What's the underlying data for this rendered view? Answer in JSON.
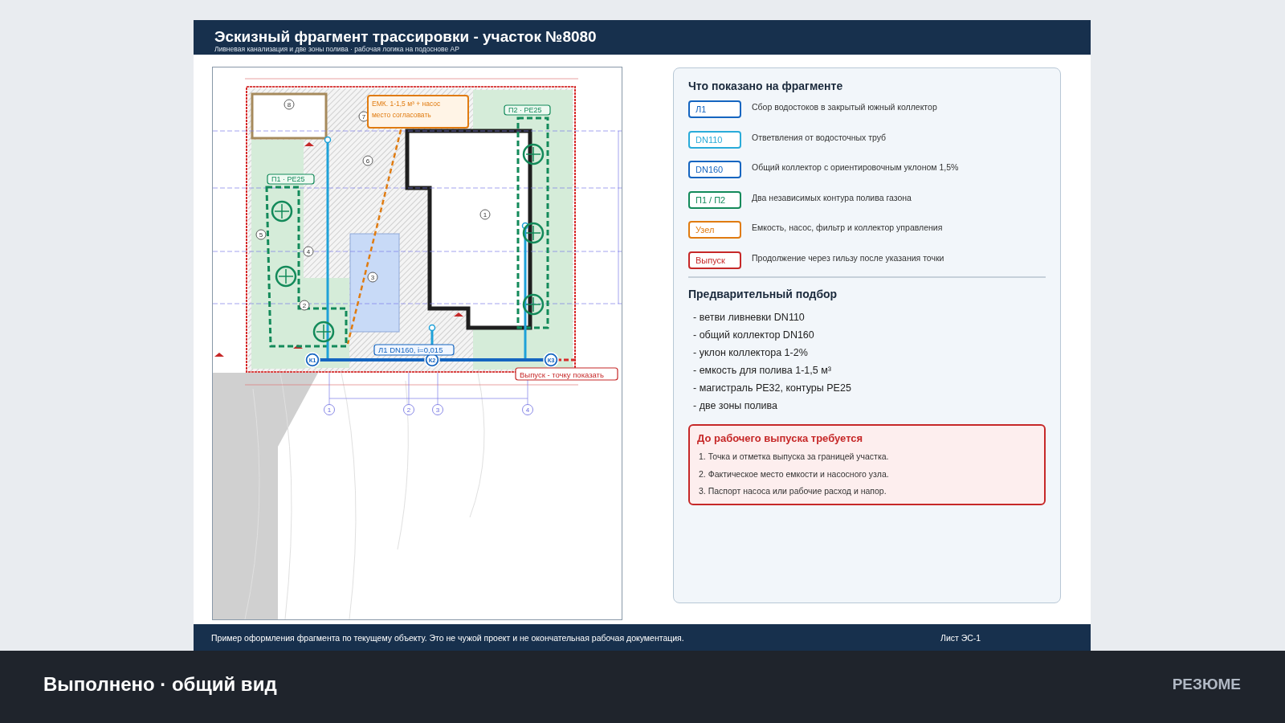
{
  "header": {
    "title": "Эскизный фрагмент трассировки - участок №8080",
    "subtitle": "Ливневая канализация и две зоны полива · рабочая логика на подоснове АР"
  },
  "plan": {
    "callouts": [
      {
        "kind": "tank",
        "lines": [
          "ЕМК. 1-1,5 м³ + насос",
          "место согласовать"
        ]
      },
      {
        "kind": "loop",
        "lines": [
          "П1 · PE25"
        ]
      },
      {
        "kind": "loop",
        "lines": [
          "П2 · PE25"
        ]
      },
      {
        "kind": "pipe",
        "lines": [
          "Л1 DN160, i=0,015"
        ]
      },
      {
        "kind": "outlet",
        "lines": [
          "Выпуск - точку показать"
        ]
      }
    ],
    "nodes": [
      "К1",
      "К2",
      "К3"
    ],
    "rooms": [
      "8",
      "7",
      "6",
      "5",
      "4",
      "3",
      "2",
      "1"
    ],
    "axes": [
      "1",
      "2",
      "3",
      "4"
    ]
  },
  "legend": {
    "title": "Что показано на фрагменте",
    "items": [
      {
        "tag": "Л1",
        "text": "Сбор водостоков в закрытый южный коллектор",
        "color": "#1565c0"
      },
      {
        "tag": "DN110",
        "text": "Ответвления от водосточных труб",
        "color": "#29abd9"
      },
      {
        "tag": "DN160",
        "text": "Общий коллектор с ориентировочным уклоном 1,5%",
        "color": "#1565c0"
      },
      {
        "tag": "П1 / П2",
        "text": "Два независимых контура полива газона",
        "color": "#138a5a"
      },
      {
        "tag": "Узел",
        "text": "Емкость, насос, фильтр и коллектор управления",
        "color": "#e07b10"
      },
      {
        "tag": "Выпуск",
        "text": "Продолжение через гильзу после указания точки",
        "color": "#c62828"
      }
    ]
  },
  "selection": {
    "title": "Предварительный подбор",
    "items": [
      "- ветви ливневки DN110",
      "- общий коллектор DN160",
      "- уклон коллектора 1-2%",
      "- емкость для полива 1-1,5 м³",
      "- магистраль PE32, контуры PE25",
      "- две зоны полива"
    ]
  },
  "required": {
    "title": "До рабочего выпуска требуется",
    "items": [
      "1. Точка и отметка выпуска за границей участка.",
      "2. Фактическое место емкости и насосного узла.",
      "3. Паспорт насоса или рабочие расход и напор."
    ]
  },
  "footer": {
    "note": "Пример оформления фрагмента по текущему объекту. Это не чужой проект и не окончательная рабочая документация.",
    "sheet": "Лист ЭС-1"
  },
  "bottom_bar": {
    "title": "Выполнено · общий вид",
    "action": "РЕЗЮМЕ"
  }
}
